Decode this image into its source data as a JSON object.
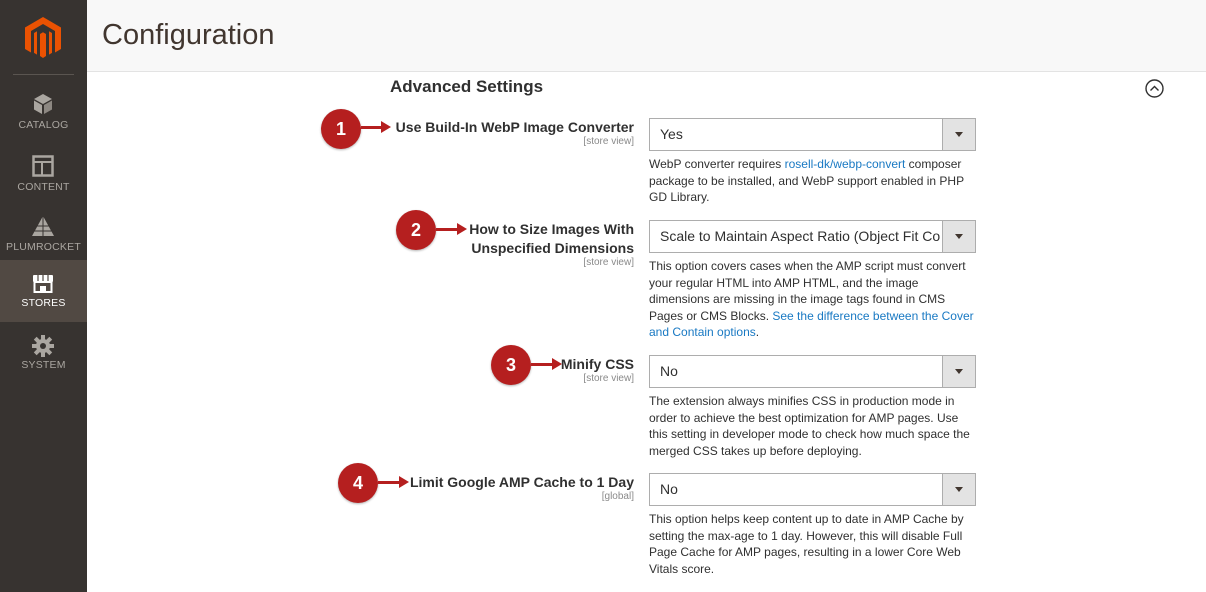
{
  "header": {
    "title": "Configuration"
  },
  "sidebar": {
    "items": [
      {
        "label": "CATALOG",
        "icon": "catalog-cube-icon",
        "active": false
      },
      {
        "label": "CONTENT",
        "icon": "content-layout-icon",
        "active": false
      },
      {
        "label": "PLUMROCKET",
        "icon": "plumrocket-pyramid-icon",
        "active": false
      },
      {
        "label": "STORES",
        "icon": "stores-storefront-icon",
        "active": true
      },
      {
        "label": "SYSTEM",
        "icon": "system-gear-icon",
        "active": false
      }
    ]
  },
  "section": {
    "title": "Advanced Settings"
  },
  "fields": [
    {
      "badge": "1",
      "label_lines": [
        "Use Build-In WebP Image Converter"
      ],
      "scope": "[store view]",
      "value": "Yes",
      "note_text": "WebP converter requires ",
      "note_link": "rosell-dk/webp-convert",
      "note_text_after": " composer package to be installed, and WebP support enabled in PHP GD Library."
    },
    {
      "badge": "2",
      "label_lines": [
        "How to Size Images With",
        "Unspecified Dimensions"
      ],
      "scope": "[store view]",
      "value": "Scale to Maintain Aspect Ratio (Object Fit Contain)",
      "note_text": "This option covers cases when the AMP script must convert your regular HTML into AMP HTML, and the image dimensions are missing in the image tags found in CMS Pages or CMS Blocks. ",
      "note_link": "See the difference between the Cover and Contain options",
      "note_text_after": "."
    },
    {
      "badge": "3",
      "label_lines": [
        "Minify CSS"
      ],
      "scope": "[store view]",
      "value": "No",
      "note_text": "The extension always minifies CSS in production mode in order to achieve the best optimization for AMP pages. Use this setting in developer mode to check how much space the merged CSS takes up before deploying.",
      "note_link": "",
      "note_text_after": ""
    },
    {
      "badge": "4",
      "label_lines": [
        "Limit Google AMP Cache to 1 Day"
      ],
      "scope": "[global]",
      "value": "No",
      "note_text": "This option helps keep content up to date in AMP Cache by setting the max-age to 1 day. However, this will disable Full Page Cache for AMP pages, resulting in a lower Core Web Vitals score.",
      "note_link": "",
      "note_text_after": ""
    }
  ],
  "colors": {
    "sidebar": "#373330",
    "sidebar_active": "#514943",
    "logo": "#eb5202",
    "callout": "#b51f1f",
    "link": "#1979c3"
  }
}
